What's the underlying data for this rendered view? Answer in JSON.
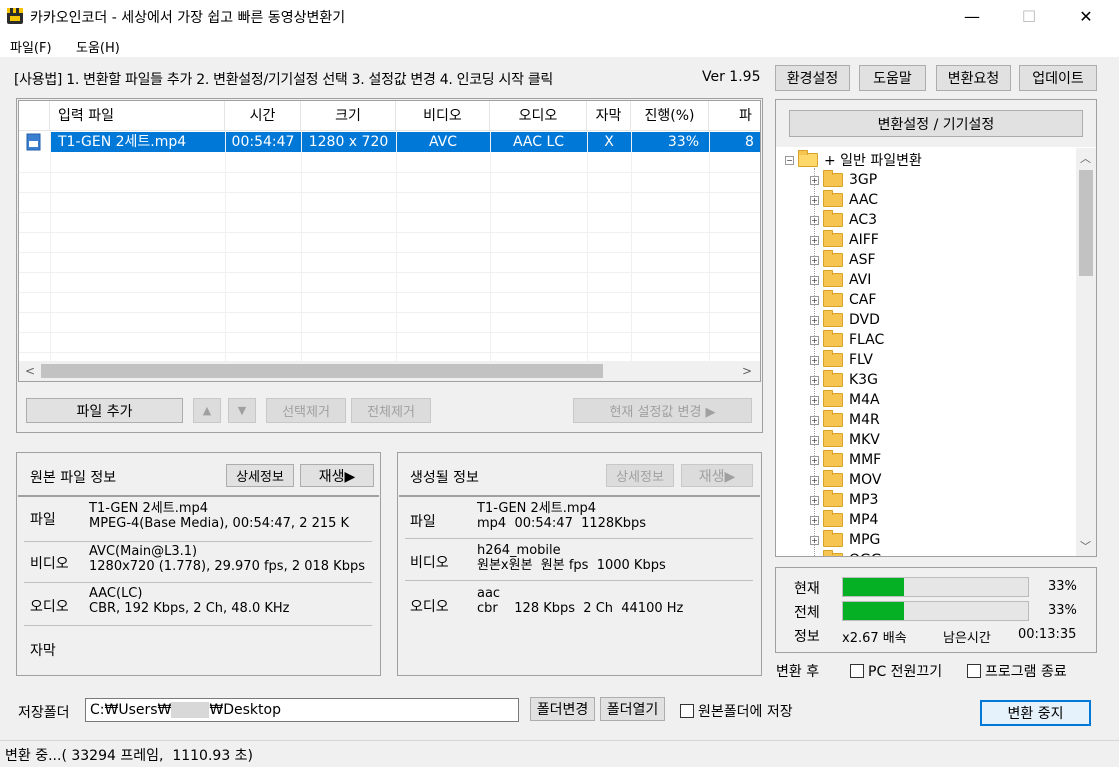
{
  "window": {
    "title": "카카오인코더 - 세상에서 가장 쉽고 빠른 동영상변환기",
    "minimize": "—",
    "maximize": "☐",
    "close": "✕"
  },
  "menu": [
    "파일(F)",
    "도움(H)"
  ],
  "usage": {
    "text": "[사용법] 1. 변환할 파일들 추가  2. 변환설정/기기설정 선택  3. 설정값 변경  4. 인코딩 시작 클릭",
    "version": "Ver 1.95"
  },
  "top_buttons": [
    "환경설정",
    "도움말",
    "변환요청",
    "업데이트"
  ],
  "file_table": {
    "columns": [
      "입력 파일",
      "시간",
      "크기",
      "비디오",
      "오디오",
      "자막",
      "진행(%)",
      "파"
    ],
    "row": [
      "T1-GEN 2세트.mp4",
      "00:54:47",
      "1280 x 720",
      "AVC",
      "AAC LC",
      "X",
      "33%",
      "8"
    ]
  },
  "file_buttons": {
    "add": "파일 추가",
    "up": "▲",
    "down": "▼",
    "remove_selected": "선택제거",
    "remove_all": "전체제거",
    "change_current": "현재 설정값 변경 ▶"
  },
  "source_info": {
    "title": "원본 파일 정보",
    "detail_btn": "상세정보",
    "play_btn": "재생▶",
    "rows": [
      {
        "label": "파일",
        "line1": "T1-GEN 2세트.mp4",
        "line2": "MPEG-4(Base Media), 00:54:47, 2 215 K"
      },
      {
        "label": "비디오",
        "line1": "AVC(Main@L3.1)",
        "line2": "1280x720 (1.778), 29.970 fps, 2 018 Kbps"
      },
      {
        "label": "오디오",
        "line1": "AAC(LC)",
        "line2": "CBR, 192 Kbps, 2 Ch, 48.0 KHz"
      },
      {
        "label": "자막",
        "line1": "",
        "line2": ""
      }
    ]
  },
  "output_info": {
    "title": "생성될 정보",
    "detail_btn": "상세정보",
    "play_btn": "재생▶",
    "rows": [
      {
        "label": "파일",
        "line1": "T1-GEN 2세트.mp4",
        "line2": "mp4  00:54:47  1128Kbps"
      },
      {
        "label": "비디오",
        "line1": "h264_mobile",
        "line2": "원본x원본  원본 fps  1000 Kbps"
      },
      {
        "label": "오디오",
        "line1": "aac",
        "line2": "cbr    128 Kbps  2 Ch  44100 Hz"
      }
    ]
  },
  "settings": {
    "button": "변환설정 / 기기설정",
    "root": "+ 일반 파일변환",
    "items": [
      "3GP",
      "AAC",
      "AC3",
      "AIFF",
      "ASF",
      "AVI",
      "CAF",
      "DVD",
      "FLAC",
      "FLV",
      "K3G",
      "M4A",
      "M4R",
      "MKV",
      "MMF",
      "MOV",
      "MP3",
      "MP4",
      "MPG",
      "OGG"
    ]
  },
  "progress": {
    "current_label": "현재",
    "current_value": 0.33,
    "current_text": "33%",
    "total_label": "전체",
    "total_value": 0.33,
    "total_text": "33%",
    "info_label": "정보",
    "speed": "x2.67 배속",
    "remaining_label": "남은시간",
    "remaining": "00:13:35"
  },
  "after": {
    "label": "변환 후",
    "pc_off": "PC 전원끄기",
    "quit": "프로그램 종료"
  },
  "save": {
    "label": "저장폴더",
    "path_prefix": "C:₩Users₩",
    "path_suffix": "₩Desktop",
    "change_btn": "폴더변경",
    "open_btn": "폴더열기",
    "same_folder": "원본폴더에 저장"
  },
  "stop_button": "변환 중지",
  "status": "변환 중...( 33294 프레임,  1110.93 초)",
  "colors": {
    "selection": "#0078d7",
    "progress": "#06b025"
  }
}
